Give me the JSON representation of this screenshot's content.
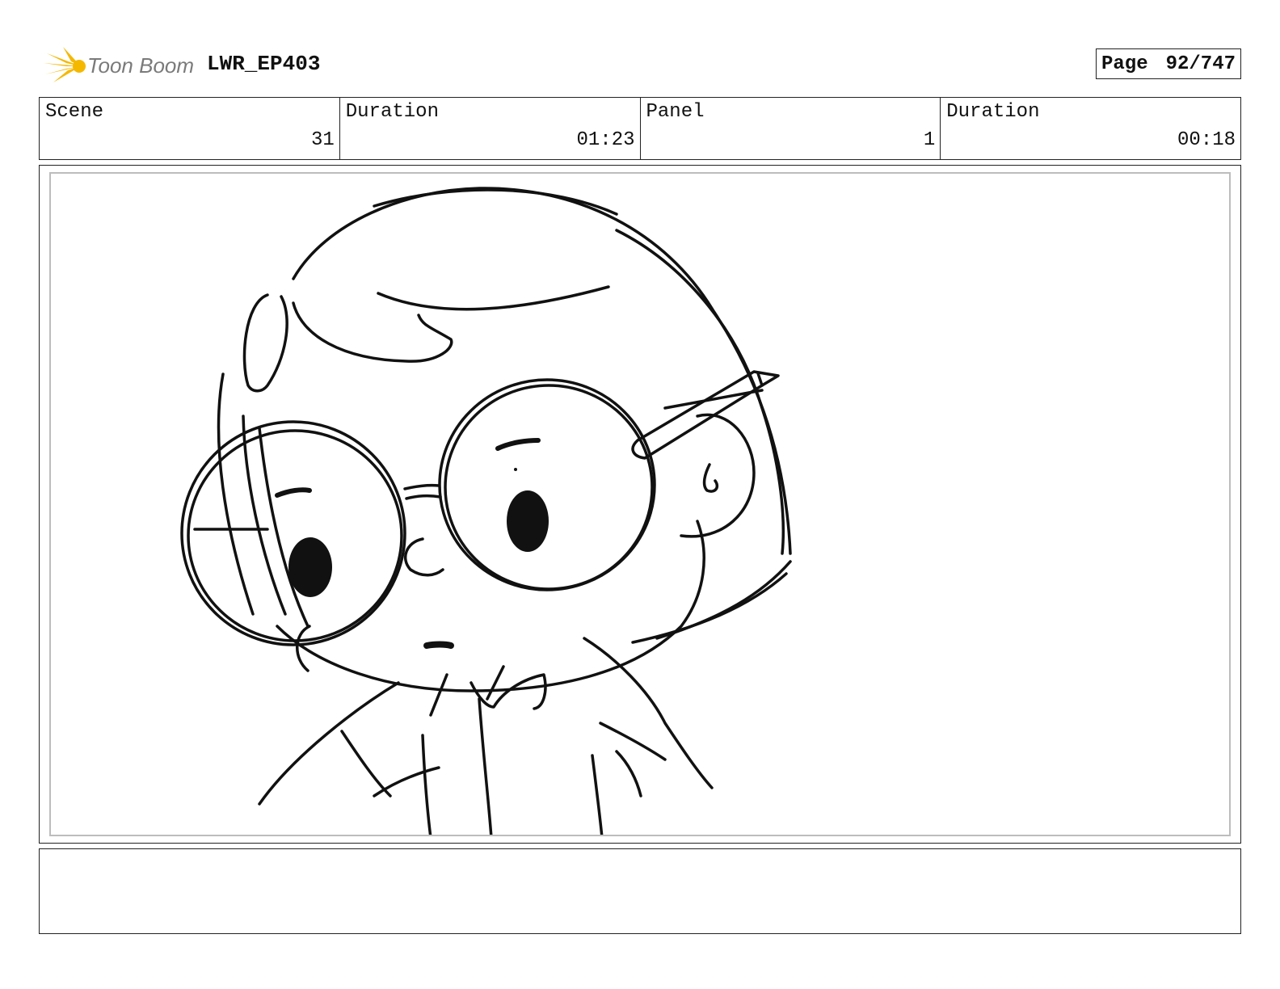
{
  "header": {
    "logo_text": "Toon Boom",
    "project": "LWR_EP403",
    "page_label": "Page",
    "page_value": "92/747"
  },
  "info": [
    {
      "label": "Scene",
      "value": "31"
    },
    {
      "label": "Duration",
      "value": "01:23"
    },
    {
      "label": "Panel",
      "value": "1"
    },
    {
      "label": "Duration",
      "value": "00:18"
    }
  ],
  "colors": {
    "logo_accent": "#f5b800",
    "ink": "#111111"
  },
  "notes": ""
}
